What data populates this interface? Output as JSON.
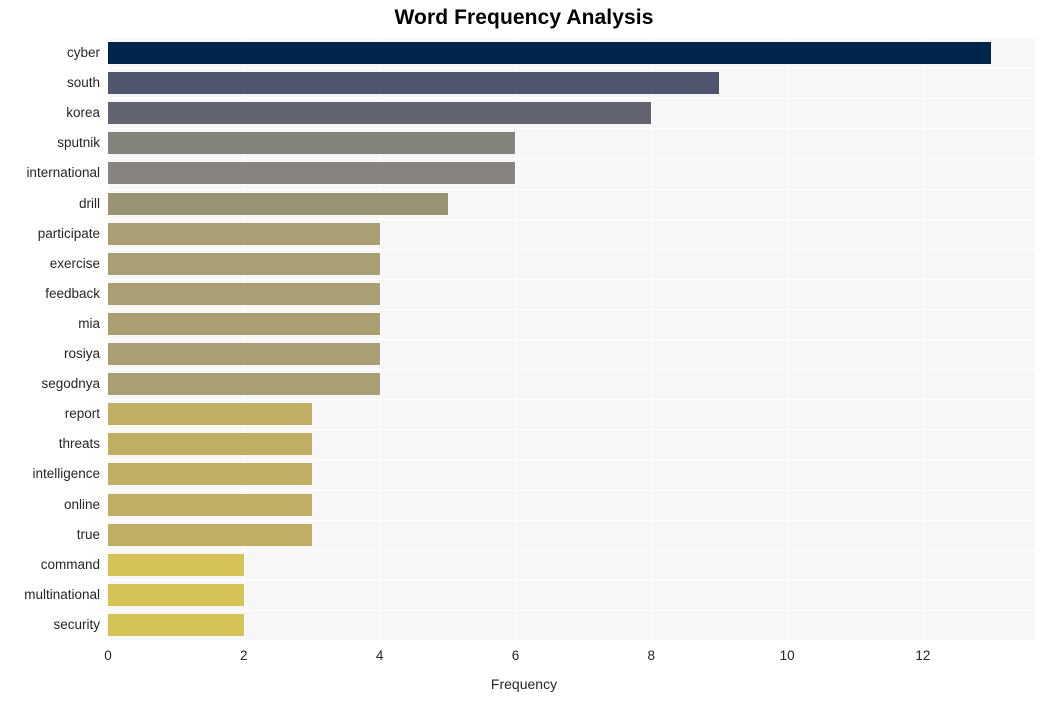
{
  "chart_data": {
    "type": "bar",
    "orientation": "horizontal",
    "title": "Word Frequency Analysis",
    "xlabel": "Frequency",
    "ylabel": "",
    "categories": [
      "cyber",
      "south",
      "korea",
      "sputnik",
      "international",
      "drill",
      "participate",
      "exercise",
      "feedback",
      "mia",
      "rosiya",
      "segodnya",
      "report",
      "threats",
      "intelligence",
      "online",
      "true",
      "command",
      "multinational",
      "security"
    ],
    "values": [
      13,
      9,
      8,
      6,
      6,
      5,
      4,
      4,
      4,
      4,
      4,
      4,
      3,
      3,
      3,
      3,
      3,
      2,
      2,
      2
    ],
    "bar_colors": [
      "#01254b",
      "#4f556d",
      "#61636f",
      "#83837b",
      "#878381",
      "#9a9374",
      "#a99f72",
      "#a99f72",
      "#a99f72",
      "#a99f72",
      "#a99f72",
      "#a99f72",
      "#bfae63",
      "#bfae63",
      "#bfae63",
      "#bfae63",
      "#bfae63",
      "#d6c358",
      "#d6c358",
      "#d6c358"
    ],
    "xticks": [
      0,
      2,
      4,
      6,
      8,
      10,
      12
    ],
    "xtick_labels": [
      "0",
      "2",
      "4",
      "6",
      "8",
      "10",
      "12"
    ],
    "xlim": [
      0,
      13.65
    ],
    "grid": "vertical-white",
    "legend": null,
    "plot_background": "#f7f7f7",
    "figure_background": "#ffffff"
  }
}
